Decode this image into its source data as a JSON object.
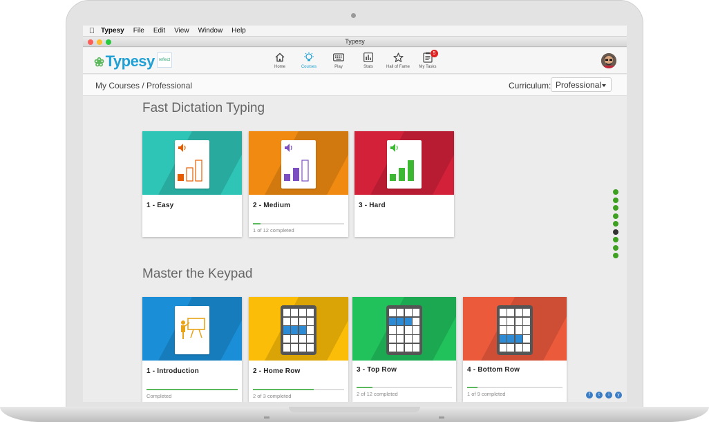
{
  "menubar": {
    "apple": "",
    "items": [
      "Typesy",
      "File",
      "Edit",
      "View",
      "Window",
      "Help"
    ]
  },
  "window": {
    "title": "Typesy"
  },
  "header": {
    "logo": "Typesy",
    "partner_logo": "reflect",
    "nav": [
      {
        "label": "Home",
        "icon": "home-icon"
      },
      {
        "label": "Courses",
        "icon": "lightbulb-icon",
        "active": true
      },
      {
        "label": "Play",
        "icon": "keyboard-icon"
      },
      {
        "label": "Stats",
        "icon": "bar-chart-icon"
      },
      {
        "label": "Hall of Fame",
        "icon": "star-icon"
      },
      {
        "label": "My Tasks",
        "icon": "clipboard-icon",
        "badge": "5"
      }
    ]
  },
  "breadcrumb": "My Courses / Professional",
  "curriculum": {
    "label": "Curriculum:",
    "value": "Professional"
  },
  "sections": [
    {
      "title": "Fast Dictation Typing",
      "cards": [
        {
          "title": "1 - Easy",
          "color": "#2ec4b6",
          "icon": "speaker-icon",
          "progress_text": "",
          "progress": null
        },
        {
          "title": "2 - Medium",
          "color": "#f08a11",
          "icon": "speaker-icon",
          "progress_text": "1 of 12 completed",
          "progress": 0.083
        },
        {
          "title": "3 - Hard",
          "color": "#d4213a",
          "icon": "speaker-icon",
          "progress_text": "",
          "progress": null
        }
      ]
    },
    {
      "title": "Master the Keypad",
      "cards": [
        {
          "title": "1 - Introduction",
          "color": "#1a8fd8",
          "icon": "presentation-icon",
          "progress_text": "Completed",
          "progress": 1.0
        },
        {
          "title": "2 - Home Row",
          "color": "#fbbd08",
          "icon": "keypad-icon",
          "progress_text": "2 of 3 completed",
          "progress": 0.667
        },
        {
          "title": "3 - Top Row",
          "color": "#21c15c",
          "icon": "keypad-icon",
          "progress_text": "2 of 12 completed",
          "progress": 0.167
        },
        {
          "title": "4 - Bottom Row",
          "color": "#ec5a3c",
          "icon": "keypad-icon",
          "progress_text": "1 of 9 completed",
          "progress": 0.111
        }
      ]
    }
  ],
  "social": [
    "f",
    "t",
    "i",
    "y"
  ]
}
